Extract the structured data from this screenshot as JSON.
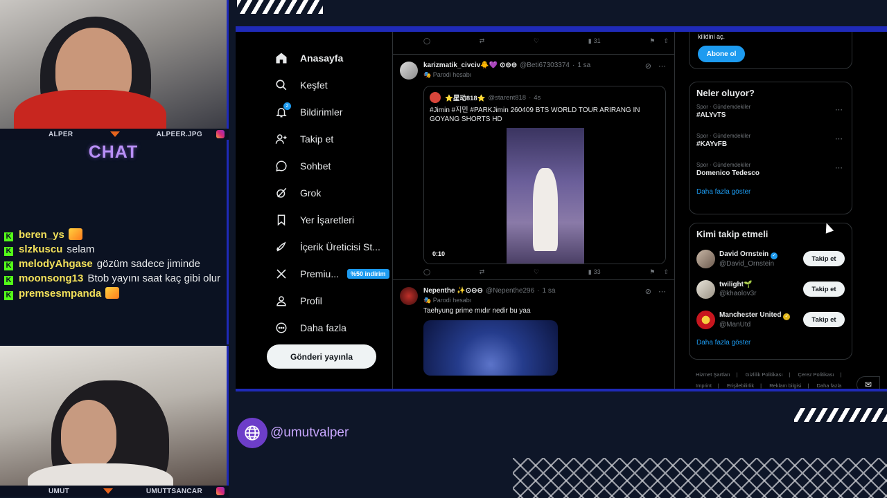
{
  "overlay": {
    "cam_top": {
      "left_name": "ALPER",
      "right_name": "ALPEER.JPG"
    },
    "cam_bottom": {
      "left_name": "UMUT",
      "right_name": "UMUTTSANCAR"
    },
    "chat_title": "CHAT",
    "chat": [
      {
        "user": "beren_ys",
        "text": "",
        "emote": true
      },
      {
        "user": "slzkuscu",
        "text": "selam",
        "emote": false
      },
      {
        "user": "melodyAhgase",
        "text": "gözüm sadece jiminde",
        "emote": false
      },
      {
        "user": "moonsong13",
        "text": "Btob yayını saat kaç gibi olur",
        "emote": false
      },
      {
        "user": "premsesmpanda",
        "text": "",
        "emote": true
      }
    ],
    "handle": "@umutvalper",
    "accent_color": "#1f2ab8",
    "kick_color": "#53fc18"
  },
  "nav": {
    "items": [
      {
        "label": "Anasayfa",
        "icon": "home-icon"
      },
      {
        "label": "Keşfet",
        "icon": "search-icon"
      },
      {
        "label": "Bildirimler",
        "icon": "bell-icon",
        "badge": "2"
      },
      {
        "label": "Takip et",
        "icon": "person-plus-icon"
      },
      {
        "label": "Sohbet",
        "icon": "chat-bubble-icon"
      },
      {
        "label": "Grok",
        "icon": "grok-icon"
      },
      {
        "label": "Yer İşaretleri",
        "icon": "bookmark-icon"
      },
      {
        "label": "İçerik Üreticisi St...",
        "icon": "rocket-icon"
      },
      {
        "label": "Premiu...",
        "icon": "x-logo-icon",
        "discount": "%50 indirim"
      },
      {
        "label": "Profil",
        "icon": "person-icon"
      },
      {
        "label": "Daha fazla",
        "icon": "more-circle-icon"
      }
    ],
    "post_button": "Gönderi yayınla"
  },
  "feed": {
    "top_actions": {
      "views": "31"
    },
    "tweets": [
      {
        "name": "karizmatik_civciv🐥💜 ⊙⊝⊖",
        "handle": "@Beti67303374",
        "time": "1 sa",
        "parody": "Parodi hesabı",
        "quote": {
          "name": "⭐星动818⭐",
          "handle": "@starent818",
          "time": "4s",
          "text": "#Jimin #지민 #PARKJimin 260409 BTS WORLD TOUR ARIRANG IN GOYANG SHORTS HD",
          "duration": "0:10"
        },
        "views": "33"
      },
      {
        "name": "Nepenthe ✨⊙⊝⊖",
        "handle": "@Nepenthe296",
        "time": "1 sa",
        "parody": "Parodi hesabı",
        "text": "Taehyung prime mıdır nedir bu yaa"
      }
    ]
  },
  "sidebar": {
    "subscribe_text": "kilidini aç.",
    "subscribe_button": "Abone ol",
    "trends_title": "Neler oluyor?",
    "trends": [
      {
        "category": "Spor · Gündemdekiler",
        "name": "#ALYvTS"
      },
      {
        "category": "Spor · Gündemdekiler",
        "name": "#KAYvFB"
      },
      {
        "category": "Spor · Gündemdekiler",
        "name": "Domenico Tedesco"
      }
    ],
    "show_more": "Daha fazla göster",
    "follow_title": "Kimi takip etmeli",
    "follow": [
      {
        "name": "David Ornstein",
        "handle": "@David_Ornstein",
        "verified": "blue",
        "button": "Takip et"
      },
      {
        "name": "twilight🌱",
        "handle": "@khaolov3r",
        "verified": "",
        "button": "Takip et"
      },
      {
        "name": "Manchester United",
        "handle": "@ManUtd",
        "verified": "gold",
        "button": "Takip et"
      }
    ],
    "show_more_2": "Daha fazla göster",
    "footer": [
      "Hizmet Şartları",
      "Gizlilik Politikası",
      "Çerez Politikası",
      "Imprint",
      "Erişilebilirlik",
      "Reklam bilgisi",
      "Daha fazla ..."
    ]
  }
}
